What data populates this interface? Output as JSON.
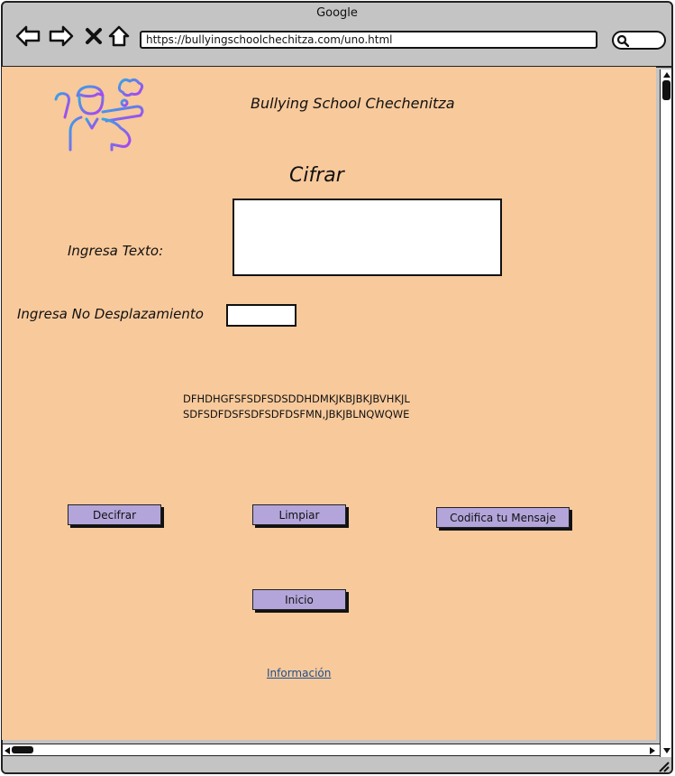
{
  "browser": {
    "window_title": "Google",
    "url": "https://bullyingschoolchechitza.com/uno.html",
    "nav_icons": [
      "back-arrow-icon",
      "forward-arrow-icon",
      "close-x-icon",
      "home-icon"
    ],
    "search_icon": "search-icon"
  },
  "header": {
    "logo_icon": "student-thinking-logo-icon",
    "site_title": "Bullying School Chechenitza"
  },
  "main": {
    "heading": "Cifrar",
    "text_label": "Ingresa Texto:",
    "text_value": "",
    "shift_label": "Ingresa No Desplazamiento",
    "shift_value": "",
    "output_lines": [
      "DFHDHGFSFSDFSDSDDHDMKJKBJBKJBVHKJL",
      "SDFSDFDSFSDFSDFDSFMN,JBKJBLNQWQWE"
    ]
  },
  "buttons": {
    "decrypt": "Decifrar",
    "clear": "Limpiar",
    "encode": "Codifica tu Mensaje",
    "home": "Inicio"
  },
  "links": {
    "info": "Información"
  },
  "colors": {
    "page_background": "#f8c99b",
    "button_fill": "#b3a5da",
    "browser_chrome": "#c4c4c4",
    "link": "#1e4e8c"
  }
}
